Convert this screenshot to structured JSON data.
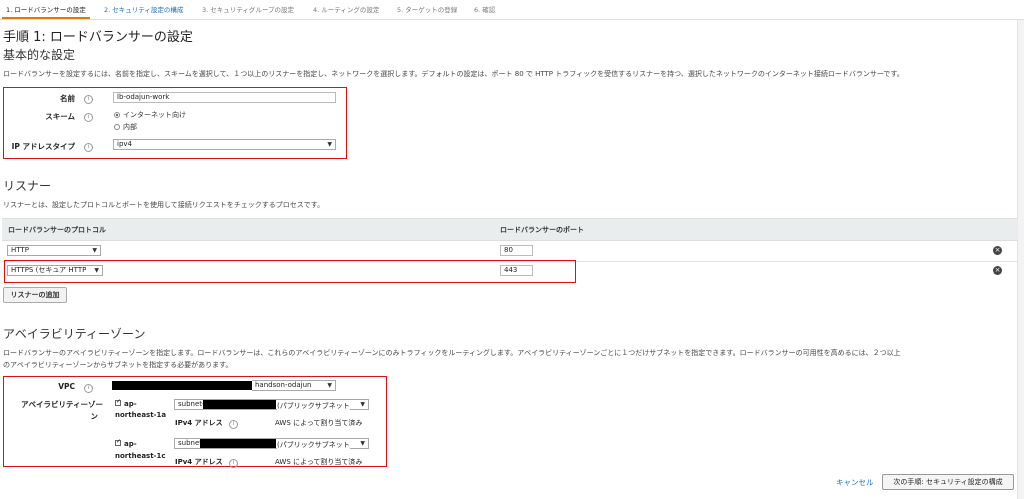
{
  "steps": [
    {
      "label": "1. ロードバランサーの設定"
    },
    {
      "label": "2. セキュリティ設定の構成"
    },
    {
      "label": "3. セキュリティグループの設定"
    },
    {
      "label": "4. ルーティングの設定"
    },
    {
      "label": "5. ターゲットの登録"
    },
    {
      "label": "6. 確認"
    }
  ],
  "page_title": "手順 1: ロードバランサーの設定",
  "basic": {
    "heading": "基本的な設定",
    "description": "ロードバランサーを設定するには、名前を指定し、スキームを選択して、１つ以上のリスナーを指定し、ネットワークを選択します。デフォルトの設定は、ポート 80 で HTTP トラフィックを受信するリスナーを持つ、選択したネットワークのインターネット接続ロードバランサーです。",
    "name_label": "名前",
    "name_value": "lb-odajun-work",
    "scheme_label": "スキーム",
    "scheme_options": [
      "インターネット向け",
      "内部"
    ],
    "scheme_selected": 0,
    "ip_label": "IP アドレスタイプ",
    "ip_value": "ipv4"
  },
  "listeners": {
    "heading": "リスナー",
    "description": "リスナーとは、設定したプロトコルとポートを使用して接続リクエストをチェックするプロセスです。",
    "col_protocol": "ロードバランサーのプロトコル",
    "col_port": "ロードバランサーのポート",
    "rows": [
      {
        "protocol": "HTTP",
        "port": "80"
      },
      {
        "protocol": "HTTPS (セキュア HTTP",
        "port": "443"
      }
    ],
    "add_button": "リスナーの追加"
  },
  "az": {
    "heading": "アベイラビリティーゾーン",
    "description_1": "ロードバランサーのアベイラビリティーゾーンを指定します。ロードバランサーは、これらのアベイラビリティーゾーンにのみトラフィックをルーティングします。アベイラビリティーゾーンごとに１つだけサブネットを指定できます。ロードバランサーの可用性を高めるには、２つ以上",
    "description_2": "のアベイラビリティーゾーンからサブネットを指定する必要があります。",
    "vpc_label": "VPC",
    "vpc_suffix": "handson-odajun",
    "az_label_1": "アベイラビリティーゾー",
    "az_label_2": "ン",
    "zones": [
      {
        "name_1": "ap-",
        "name_2": "northeast-1a",
        "subnet_prefix": "subnet-",
        "subnet_suffix": "(パブリックサブネット",
        "ipv4_label": "IPv4 アドレス",
        "ipv4_value": "AWS によって割り当て済み"
      },
      {
        "name_1": "ap-",
        "name_2": "northeast-1c",
        "subnet_prefix": "subnet",
        "subnet_suffix": "(パブリックサブネット",
        "ipv4_label": "IPv4 アドレス",
        "ipv4_value": "AWS によって割り当て済み"
      }
    ]
  },
  "footer": {
    "cancel": "キャンセル",
    "next": "次の手順: セキュリティ設定の構成"
  }
}
